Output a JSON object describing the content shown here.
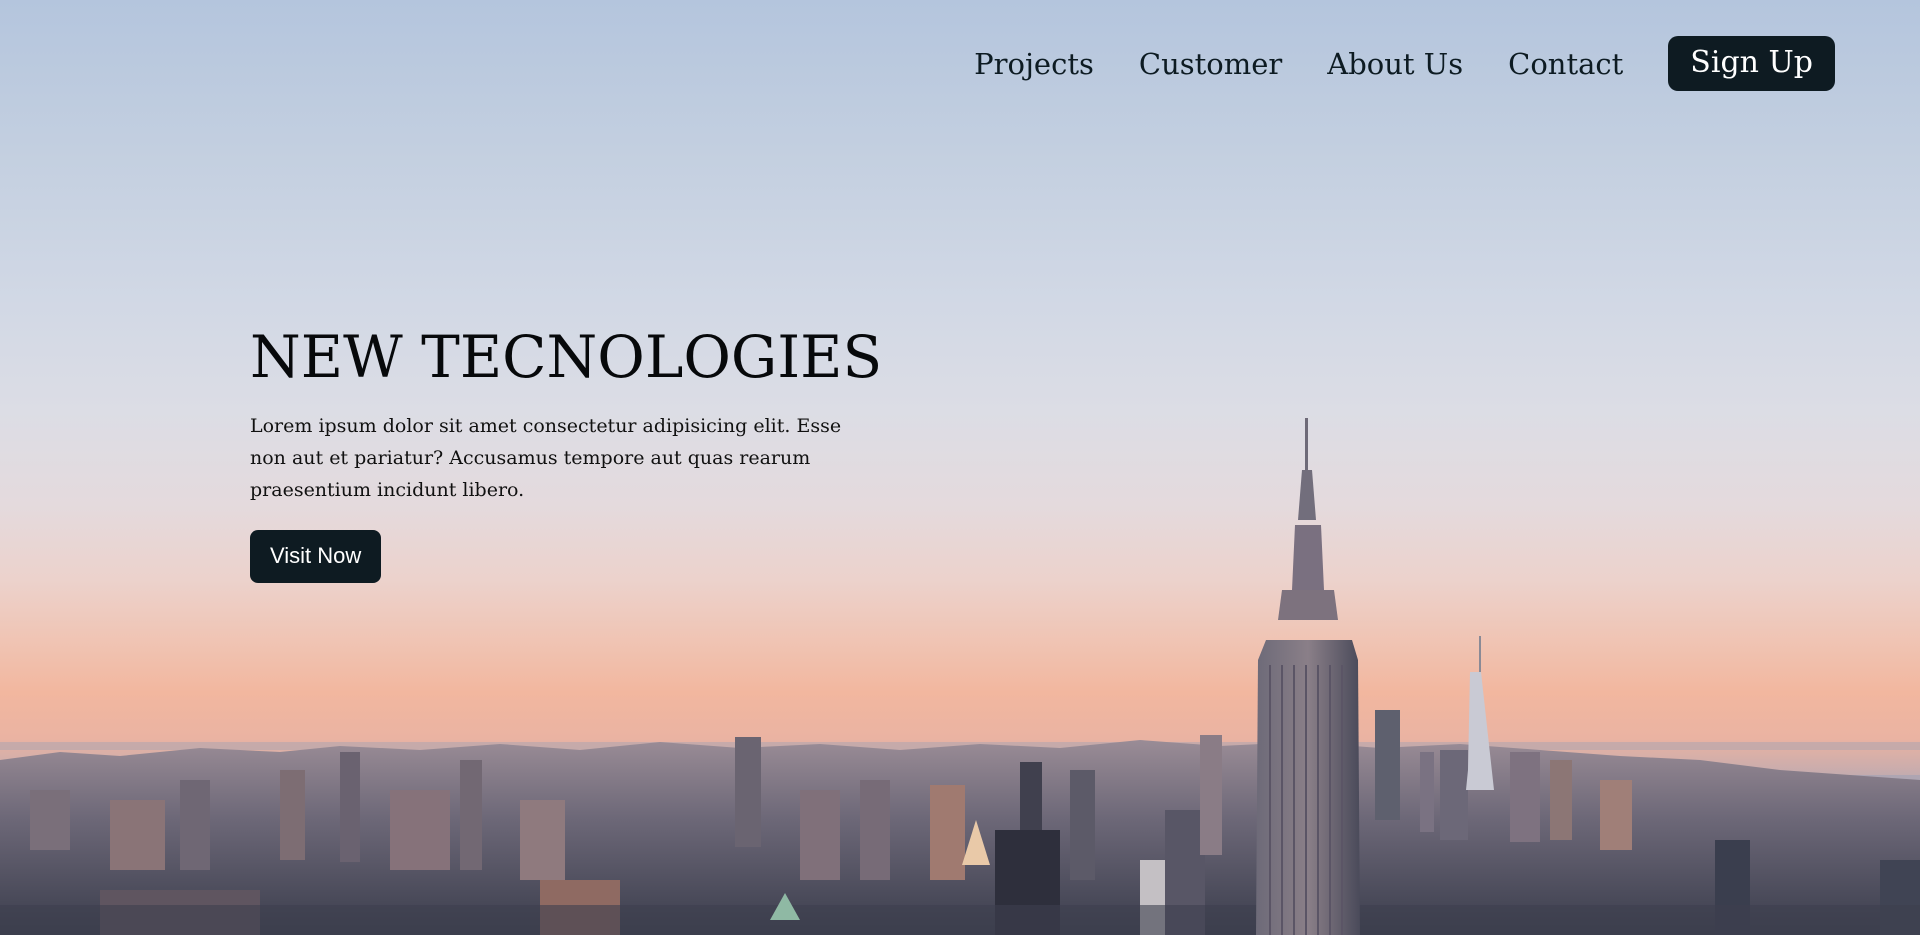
{
  "nav": {
    "links": [
      "Projects",
      "Customer",
      "About Us",
      "Contact"
    ],
    "signup_label": "Sign Up"
  },
  "hero": {
    "title": "NEW TECNOLOGIES",
    "text": "Lorem ipsum dolor sit amet consectetur adipisicing elit. Esse non aut et pariatur? Accusamus tempore aut quas rearum praesentium incidunt libero.",
    "button_label": "Visit Now"
  },
  "colors": {
    "button_bg": "#0e1b22",
    "button_text": "#ffffff",
    "text_dark": "#0d1b22"
  }
}
